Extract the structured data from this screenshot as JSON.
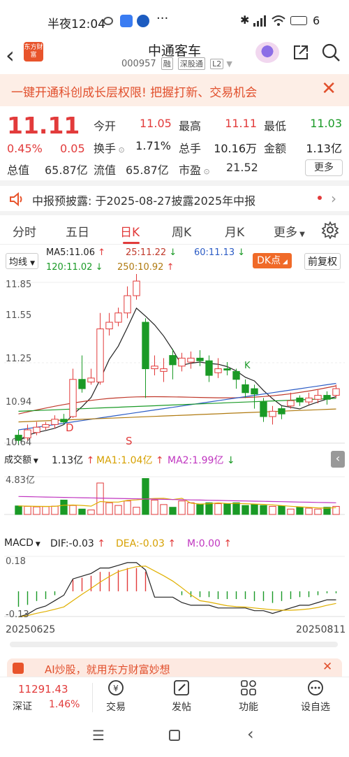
{
  "status": {
    "time": "半夜12:04",
    "battery": "6"
  },
  "header": {
    "title": "中通客车",
    "code": "000957",
    "tags": [
      "融",
      "深股通",
      "L2"
    ],
    "logo_text": "东方财富"
  },
  "banner": {
    "text": "一键开通科创成长层权限! 把握打新、交易机会"
  },
  "quote": {
    "price": "11.11",
    "change_pct": "0.45%",
    "change": "0.05",
    "open_label": "今开",
    "open": "11.05",
    "high_label": "最高",
    "high": "11.11",
    "low_label": "最低",
    "low": "11.03",
    "turnover_label": "换手",
    "turnover": "1.71%",
    "volume_label": "总手",
    "volume": "10.16万",
    "amount_label": "金额",
    "amount": "1.13亿",
    "mktcap_label": "总值",
    "mktcap": "65.87亿",
    "float_label": "流值",
    "float": "65.87亿",
    "pe_label": "市盈",
    "pe": "21.52",
    "more": "更多"
  },
  "notice": {
    "text": "中报预披露: 于2025-08-27披露2025年中报"
  },
  "tabs": [
    "分时",
    "五日",
    "日K",
    "周K",
    "月K",
    "更多"
  ],
  "chart_header": {
    "ma_selector": "均线",
    "ma5": "MA5:11.06",
    "ma25": "25:11.22",
    "ma60": "60:11.13",
    "ma120": "120:11.02",
    "ma250": "250:10.92",
    "dk": "DK点",
    "adjust": "前复权"
  },
  "price_axis": [
    "11.85",
    "11.55",
    "11.25",
    "10.94",
    "10.64"
  ],
  "markers": {
    "d": "D",
    "s": "S",
    "k": "K"
  },
  "volume_header": {
    "selector": "成交额",
    "value": "1.13亿",
    "ma1": "MA1:1.04亿",
    "ma2": "MA2:1.99亿",
    "axis_top": "4.83亿"
  },
  "macd_header": {
    "selector": "MACD",
    "dif": "DIF:-0.03",
    "dea": "DEA:-0.03",
    "m": "M:0.00",
    "axis_top": "0.18",
    "axis_bottom": "-0.13"
  },
  "dates": {
    "start": "20250625",
    "end": "20250811"
  },
  "ai_bar": {
    "text": "AI炒股，就用东方财富妙想"
  },
  "bottom_nav": {
    "index_value": "11291.43",
    "index_name": "深证",
    "index_pct": "1.46%",
    "items": [
      "交易",
      "发帖",
      "功能",
      "设自选"
    ]
  },
  "colors": {
    "up": "#e23b3b",
    "down": "#1a9a26",
    "accent": "#e8542c"
  },
  "chart_data": {
    "type": "candlestick",
    "ylim": [
      10.64,
      11.85
    ],
    "candles": [
      {
        "o": 10.7,
        "c": 10.66,
        "h": 10.74,
        "l": 10.63
      },
      {
        "o": 10.68,
        "c": 10.74,
        "h": 10.78,
        "l": 10.66
      },
      {
        "o": 10.72,
        "c": 10.76,
        "h": 10.8,
        "l": 10.7
      },
      {
        "o": 10.76,
        "c": 10.78,
        "h": 10.8,
        "l": 10.74
      },
      {
        "o": 10.78,
        "c": 10.82,
        "h": 10.85,
        "l": 10.75
      },
      {
        "o": 10.82,
        "c": 10.8,
        "h": 10.86,
        "l": 10.78
      },
      {
        "o": 10.84,
        "c": 11.12,
        "h": 11.2,
        "l": 10.83
      },
      {
        "o": 11.12,
        "c": 11.05,
        "h": 11.3,
        "l": 11.02
      },
      {
        "o": 11.1,
        "c": 11.13,
        "h": 11.2,
        "l": 11.08
      },
      {
        "o": 11.1,
        "c": 11.5,
        "h": 11.62,
        "l": 11.08
      },
      {
        "o": 11.5,
        "c": 11.55,
        "h": 11.62,
        "l": 11.45
      },
      {
        "o": 11.55,
        "c": 11.62,
        "h": 11.66,
        "l": 11.52
      },
      {
        "o": 11.62,
        "c": 11.75,
        "h": 11.82,
        "l": 11.58
      },
      {
        "o": 11.75,
        "c": 11.86,
        "h": 11.92,
        "l": 11.72
      },
      {
        "o": 11.55,
        "c": 11.2,
        "h": 11.58,
        "l": 10.98
      },
      {
        "o": 11.2,
        "c": 11.22,
        "h": 11.3,
        "l": 11.15
      },
      {
        "o": 11.18,
        "c": 11.2,
        "h": 11.28,
        "l": 11.1
      },
      {
        "o": 11.3,
        "c": 11.23,
        "h": 11.35,
        "l": 11.12
      },
      {
        "o": 11.22,
        "c": 11.28,
        "h": 11.32,
        "l": 11.18
      },
      {
        "o": 11.25,
        "c": 11.28,
        "h": 11.33,
        "l": 11.2
      },
      {
        "o": 11.28,
        "c": 11.26,
        "h": 11.34,
        "l": 11.22
      },
      {
        "o": 11.26,
        "c": 11.15,
        "h": 11.3,
        "l": 11.1
      },
      {
        "o": 11.17,
        "c": 11.2,
        "h": 11.28,
        "l": 11.13
      },
      {
        "o": 11.2,
        "c": 11.19,
        "h": 11.25,
        "l": 11.15
      },
      {
        "o": 11.18,
        "c": 11.12,
        "h": 11.2,
        "l": 11.05
      },
      {
        "o": 11.08,
        "c": 11.02,
        "h": 11.12,
        "l": 10.98
      },
      {
        "o": 11.05,
        "c": 11.01,
        "h": 11.08,
        "l": 10.9
      },
      {
        "o": 10.95,
        "c": 10.84,
        "h": 10.98,
        "l": 10.8
      },
      {
        "o": 10.84,
        "c": 10.88,
        "h": 10.92,
        "l": 10.78
      },
      {
        "o": 10.9,
        "c": 10.86,
        "h": 10.92,
        "l": 10.82
      },
      {
        "o": 10.92,
        "c": 10.96,
        "h": 11.02,
        "l": 10.9
      },
      {
        "o": 10.98,
        "c": 10.95,
        "h": 11.0,
        "l": 10.92
      },
      {
        "o": 10.95,
        "c": 10.98,
        "h": 11.02,
        "l": 10.93
      },
      {
        "o": 10.97,
        "c": 11.0,
        "h": 11.04,
        "l": 10.94
      },
      {
        "o": 11.0,
        "c": 10.97,
        "h": 11.03,
        "l": 10.93
      },
      {
        "o": 11.0,
        "c": 11.05,
        "h": 11.08,
        "l": 10.98
      }
    ],
    "volumes": [
      0.95,
      0.9,
      0.85,
      0.88,
      0.92,
      1.6,
      1.0,
      0.6,
      0.5,
      3.5,
      1.3,
      1.0,
      1.5,
      0.8,
      4.0,
      1.6,
      1.1,
      0.8,
      1.5,
      1.3,
      1.1,
      1.3,
      1.2,
      1.2,
      1.3,
      1.0,
      1.1,
      1.0,
      0.9,
      0.95,
      0.6,
      0.8,
      0.7,
      0.6,
      0.8,
      0.9
    ],
    "macd_hist": [
      -0.08,
      -0.07,
      -0.05,
      -0.04,
      -0.02,
      0.0,
      0.06,
      0.07,
      0.08,
      0.1,
      0.1,
      0.11,
      0.12,
      0.12,
      0.1,
      0.0,
      0.0,
      0.0,
      -0.02,
      -0.03,
      -0.03,
      -0.03,
      -0.04,
      -0.04,
      -0.04,
      -0.04,
      -0.05,
      -0.05,
      -0.06,
      -0.05,
      -0.04,
      -0.03,
      -0.03,
      -0.02,
      -0.01,
      -0.01
    ],
    "macd_ylim": [
      -0.13,
      0.18
    ]
  }
}
